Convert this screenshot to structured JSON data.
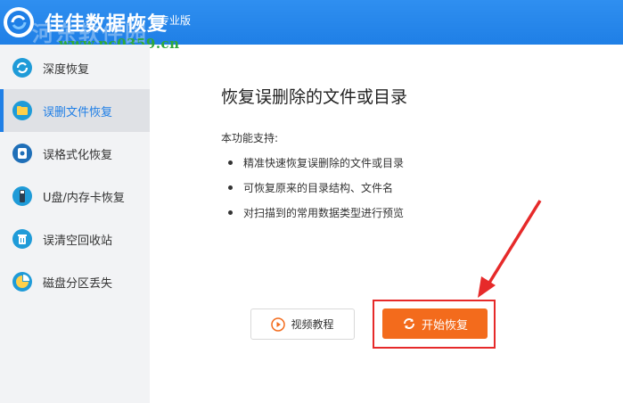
{
  "header": {
    "app_title": "佳佳数据恢复",
    "edition": "专业版",
    "watermark_text": "河东软件园",
    "watermark_url": "www.pc0359.cn",
    "bar_color": "#1f7fe6"
  },
  "sidebar": {
    "items": [
      {
        "label": "深度恢复",
        "icon": "deep-recovery-icon",
        "active": false
      },
      {
        "label": "误删文件恢复",
        "icon": "folder-icon",
        "active": true
      },
      {
        "label": "误格式化恢复",
        "icon": "disk-format-icon",
        "active": false
      },
      {
        "label": "U盘/内存卡恢复",
        "icon": "usb-drive-icon",
        "active": false
      },
      {
        "label": "误清空回收站",
        "icon": "recycle-bin-icon",
        "active": false
      },
      {
        "label": "磁盘分区丢失",
        "icon": "partition-icon",
        "active": false
      }
    ]
  },
  "main": {
    "title": "恢复误删除的文件或目录",
    "support_heading": "本功能支持:",
    "features": [
      "精准快速恢复误删除的文件或目录",
      "可恢复原来的目录结构、文件名",
      "对扫描到的常用数据类型进行预览"
    ]
  },
  "buttons": {
    "video_tutorial": "视频教程",
    "start_recovery": "开始恢复",
    "start_color": "#f36b1c"
  },
  "annotation": {
    "highlight_color": "#e62a2a"
  }
}
